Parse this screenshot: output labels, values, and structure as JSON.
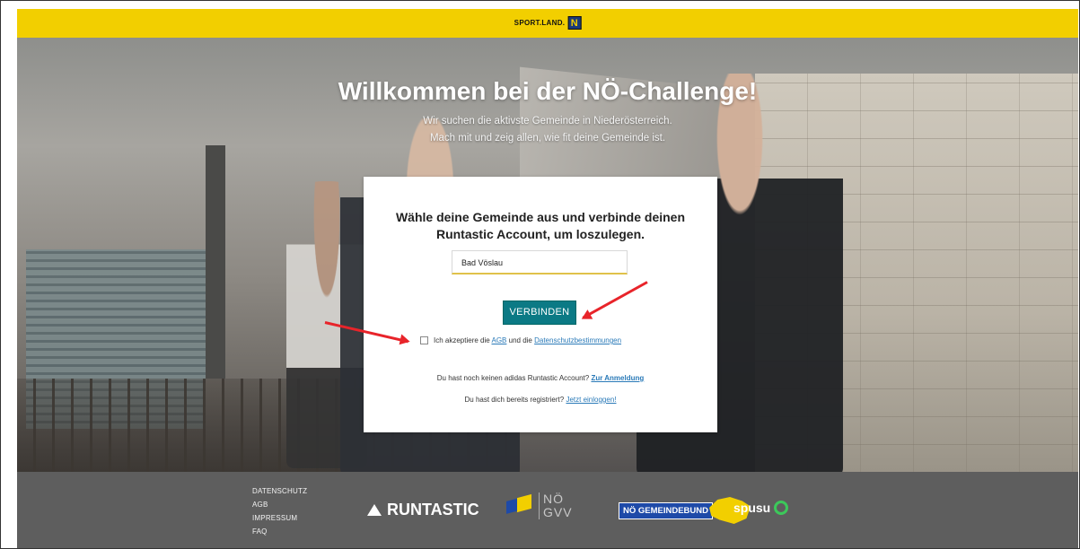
{
  "header": {
    "logo_text": "SPORT.LAND.",
    "logo_badge": "N"
  },
  "hero": {
    "title": "Willkommen bei der NÖ-Challenge!",
    "subtitle_line1": "Wir suchen die aktivste Gemeinde in Niederösterreich.",
    "subtitle_line2": "Mach mit und zeig allen, wie fit deine Gemeinde ist."
  },
  "card": {
    "title_line1": "Wähle deine Gemeinde aus und verbinde deinen",
    "title_line2": "Runtastic Account, um loszulegen.",
    "gemeinde_value": "Bad Vöslau",
    "connect_button": "VERBINDEN",
    "accept_prefix": "Ich akzeptiere die",
    "accept_agb": "AGB",
    "accept_middle": "und die",
    "accept_privacy": "Datenschutzbestimmungen",
    "no_account_text": "Du hast noch keinen adidas Runtastic Account?",
    "no_account_link": "Zur Anmeldung",
    "registered_text": "Du hast dich bereits registriert?",
    "registered_link": "Jetzt einloggen!"
  },
  "footer": {
    "links": [
      "DATENSCHUTZ",
      "AGB",
      "IMPRESSUM",
      "FAQ"
    ],
    "partners": {
      "runtastic": "RUNTASTIC",
      "gvv_line1": "NÖ",
      "gvv_line2": "GVV",
      "gemeindebund": "NÖ GEMEINDEBUND",
      "spusu": "spusu"
    }
  },
  "colors": {
    "accent_yellow": "#f2cf00",
    "button_teal": "#0b7a85",
    "annotation_red": "#e8242a",
    "footer_grey": "#5e5e5e"
  },
  "icons": [
    "adidas-logo-icon",
    "noe-flag-icon",
    "noe-map-icon",
    "spusu-ring-icon",
    "red-arrow-icon"
  ]
}
